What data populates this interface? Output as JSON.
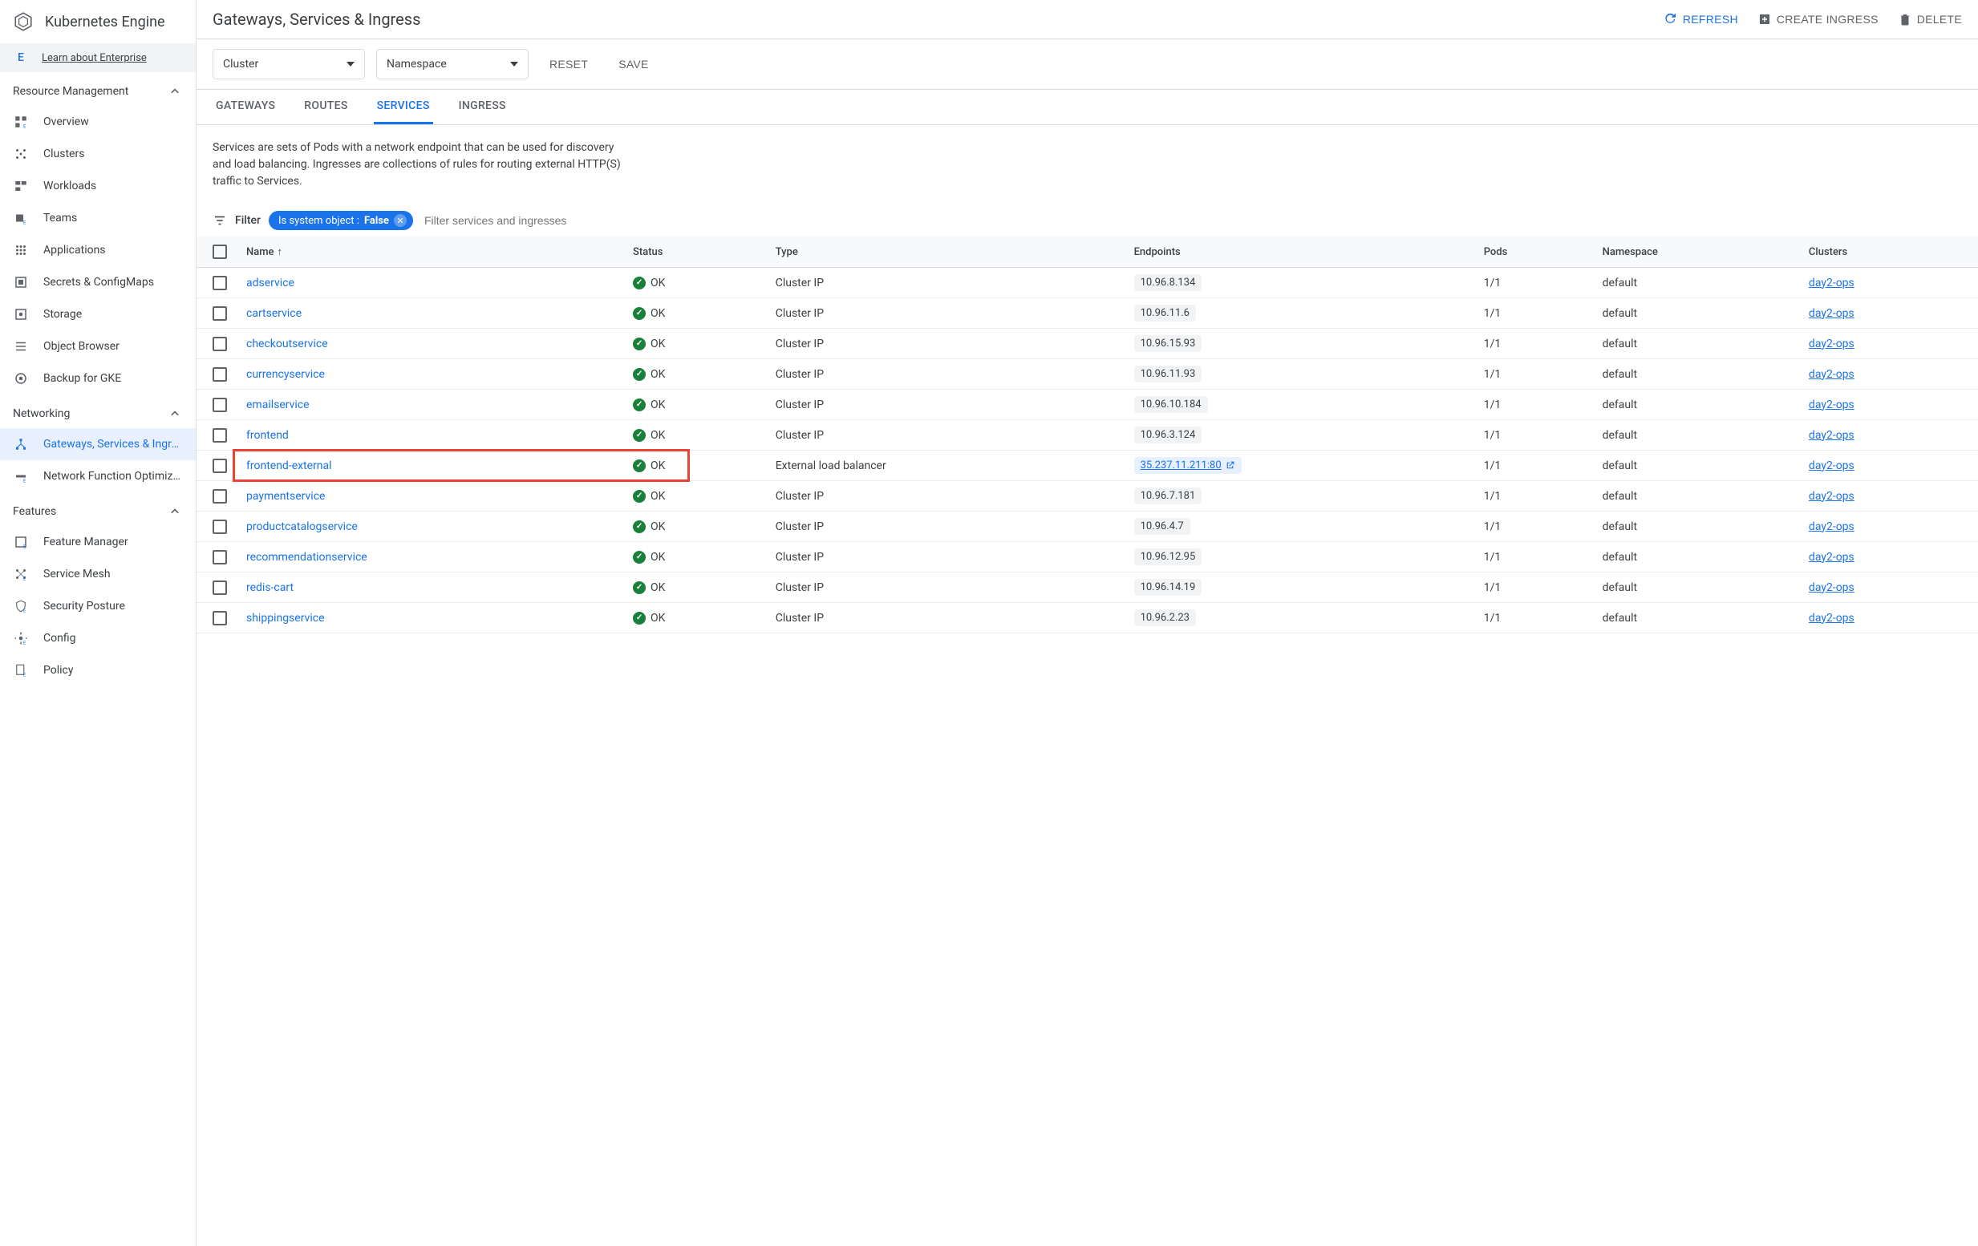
{
  "sidebar": {
    "product_title": "Kubernetes Engine",
    "enterprise_badge": "E",
    "enterprise_link": "Learn about Enterprise",
    "sections": {
      "resource_management": {
        "label": "Resource Management",
        "items": [
          {
            "label": "Overview"
          },
          {
            "label": "Clusters"
          },
          {
            "label": "Workloads"
          },
          {
            "label": "Teams"
          },
          {
            "label": "Applications"
          },
          {
            "label": "Secrets & ConfigMaps"
          },
          {
            "label": "Storage"
          },
          {
            "label": "Object Browser"
          },
          {
            "label": "Backup for GKE"
          }
        ]
      },
      "networking": {
        "label": "Networking",
        "items": [
          {
            "label": "Gateways, Services & Ingre…",
            "active": true
          },
          {
            "label": "Network Function Optimiz…"
          }
        ]
      },
      "features": {
        "label": "Features",
        "items": [
          {
            "label": "Feature Manager"
          },
          {
            "label": "Service Mesh"
          },
          {
            "label": "Security Posture"
          },
          {
            "label": "Config"
          },
          {
            "label": "Policy"
          }
        ]
      }
    }
  },
  "toolbar": {
    "title": "Gateways, Services & Ingress",
    "refresh": "REFRESH",
    "create_ingress": "CREATE INGRESS",
    "delete": "DELETE"
  },
  "filter_dropdowns": {
    "cluster": "Cluster",
    "namespace": "Namespace",
    "reset": "RESET",
    "save": "SAVE"
  },
  "tabs": {
    "gateways": "GATEWAYS",
    "routes": "ROUTES",
    "services": "SERVICES",
    "ingress": "INGRESS"
  },
  "description": "Services are sets of Pods with a network endpoint that can be used for discovery and load balancing. Ingresses are collections of rules for routing external HTTP(S) traffic to Services.",
  "filter": {
    "label": "Filter",
    "chip_key": "Is system object :",
    "chip_value": "False",
    "placeholder": "Filter services and ingresses"
  },
  "table": {
    "headers": {
      "name": "Name",
      "status": "Status",
      "type": "Type",
      "endpoints": "Endpoints",
      "pods": "Pods",
      "namespace": "Namespace",
      "clusters": "Clusters"
    },
    "rows": [
      {
        "name": "adservice",
        "status": "OK",
        "type": "Cluster IP",
        "endpoint": "10.96.8.134",
        "pods": "1/1",
        "namespace": "default",
        "cluster": "day2-ops",
        "highlighted": false
      },
      {
        "name": "cartservice",
        "status": "OK",
        "type": "Cluster IP",
        "endpoint": "10.96.11.6",
        "pods": "1/1",
        "namespace": "default",
        "cluster": "day2-ops",
        "highlighted": false
      },
      {
        "name": "checkoutservice",
        "status": "OK",
        "type": "Cluster IP",
        "endpoint": "10.96.15.93",
        "pods": "1/1",
        "namespace": "default",
        "cluster": "day2-ops",
        "highlighted": false
      },
      {
        "name": "currencyservice",
        "status": "OK",
        "type": "Cluster IP",
        "endpoint": "10.96.11.93",
        "pods": "1/1",
        "namespace": "default",
        "cluster": "day2-ops",
        "highlighted": false
      },
      {
        "name": "emailservice",
        "status": "OK",
        "type": "Cluster IP",
        "endpoint": "10.96.10.184",
        "pods": "1/1",
        "namespace": "default",
        "cluster": "day2-ops",
        "highlighted": false
      },
      {
        "name": "frontend",
        "status": "OK",
        "type": "Cluster IP",
        "endpoint": "10.96.3.124",
        "pods": "1/1",
        "namespace": "default",
        "cluster": "day2-ops",
        "highlighted": false
      },
      {
        "name": "frontend-external",
        "status": "OK",
        "type": "External load balancer",
        "endpoint": "35.237.11.211:80",
        "pods": "1/1",
        "namespace": "default",
        "cluster": "day2-ops",
        "highlighted": true,
        "external": true
      },
      {
        "name": "paymentservice",
        "status": "OK",
        "type": "Cluster IP",
        "endpoint": "10.96.7.181",
        "pods": "1/1",
        "namespace": "default",
        "cluster": "day2-ops",
        "highlighted": false
      },
      {
        "name": "productcatalogservice",
        "status": "OK",
        "type": "Cluster IP",
        "endpoint": "10.96.4.7",
        "pods": "1/1",
        "namespace": "default",
        "cluster": "day2-ops",
        "highlighted": false
      },
      {
        "name": "recommendationservice",
        "status": "OK",
        "type": "Cluster IP",
        "endpoint": "10.96.12.95",
        "pods": "1/1",
        "namespace": "default",
        "cluster": "day2-ops",
        "highlighted": false
      },
      {
        "name": "redis-cart",
        "status": "OK",
        "type": "Cluster IP",
        "endpoint": "10.96.14.19",
        "pods": "1/1",
        "namespace": "default",
        "cluster": "day2-ops",
        "highlighted": false
      },
      {
        "name": "shippingservice",
        "status": "OK",
        "type": "Cluster IP",
        "endpoint": "10.96.2.23",
        "pods": "1/1",
        "namespace": "default",
        "cluster": "day2-ops",
        "highlighted": false
      }
    ]
  }
}
